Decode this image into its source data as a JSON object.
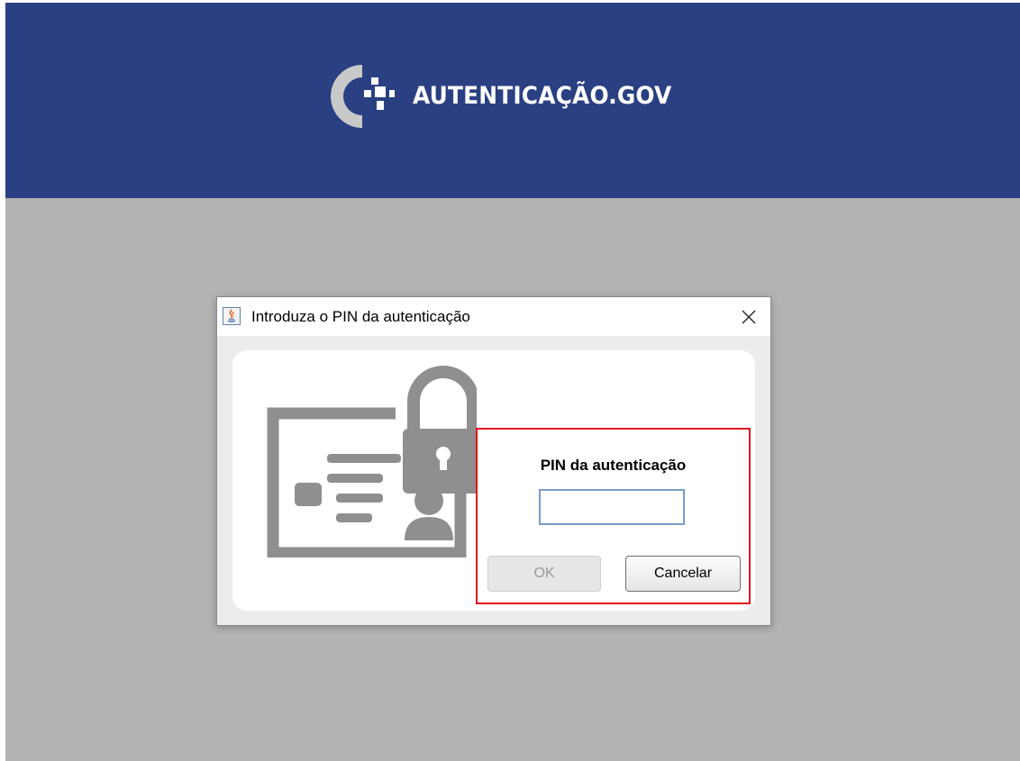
{
  "banner": {
    "logo_text": "AUTENTICAÇÃO.GOV",
    "background_color": "#2a4082",
    "logo_icon": "autenticacao-gov-logo"
  },
  "dialog": {
    "title": "Introduza o PIN da autenticação",
    "app_icon": "java-icon",
    "close_icon": "close-icon",
    "illustration": "id-card-lock-illustration",
    "pin_label": "PIN da autenticação",
    "pin_value": "",
    "ok_label": "OK",
    "ok_disabled": true,
    "cancel_label": "Cancelar",
    "highlight_color": "#e0141c"
  }
}
